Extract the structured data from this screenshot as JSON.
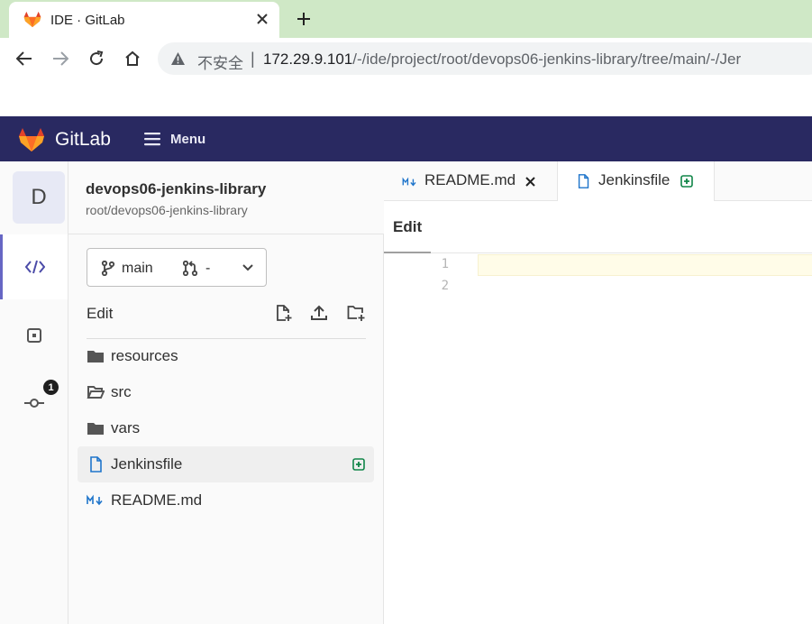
{
  "browser": {
    "tab_title": "IDE · GitLab",
    "security_label": "不安全",
    "separator": "|",
    "url_host": "172.29.9.101",
    "url_path": "/-/ide/project/root/devops06-jenkins-library/tree/main/-/Jer"
  },
  "header": {
    "brand": "GitLab",
    "menu_label": "Menu"
  },
  "project": {
    "avatar_letter": "D",
    "name": "devops06-jenkins-library",
    "path": "root/devops06-jenkins-library"
  },
  "activity": {
    "commit_badge": "1"
  },
  "branch": {
    "name": "main",
    "merge_request": "-"
  },
  "tree": {
    "header_label": "Edit",
    "items": [
      {
        "name": "resources",
        "type": "folder"
      },
      {
        "name": "src",
        "type": "folder-open"
      },
      {
        "name": "vars",
        "type": "folder"
      },
      {
        "name": "Jenkinsfile",
        "type": "file",
        "status": "added"
      },
      {
        "name": "README.md",
        "type": "markdown"
      }
    ]
  },
  "editor": {
    "tabs": [
      {
        "name": "README.md",
        "icon": "markdown-icon"
      },
      {
        "name": "Jenkinsfile",
        "icon": "file-icon",
        "status": "added"
      }
    ],
    "mode_label": "Edit",
    "line_numbers": [
      "1",
      "2"
    ]
  },
  "colors": {
    "header_bg": "#292961",
    "tab_strip": "#cfe8c6",
    "added_status": "#108548",
    "active_indicator": "#6666c4",
    "file_icon": "#1f75cb"
  }
}
